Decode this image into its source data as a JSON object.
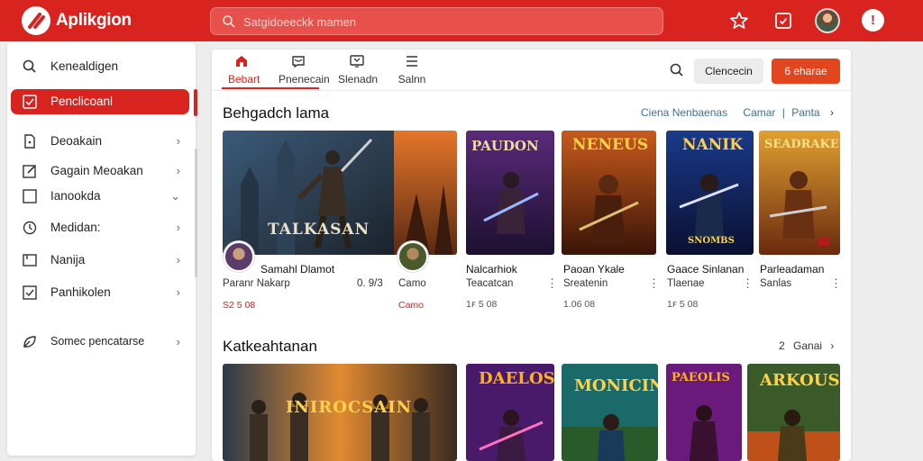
{
  "app": {
    "title": "Aplikgion"
  },
  "search": {
    "placeholder": "Satgidoeeckk mamen"
  },
  "sidebar": {
    "items": [
      {
        "label": "Kenealdigen",
        "icon": "search-icon"
      },
      {
        "label": "Penclicoanl",
        "icon": "checkbox-icon",
        "active": true
      },
      {
        "label": "Deoakain",
        "icon": "document-icon",
        "chevron": "›"
      },
      {
        "label": "Gagain Meoakan",
        "icon": "edit-icon",
        "chevron": "›"
      },
      {
        "label": "Ianookda",
        "icon": "square-icon",
        "chevron": "⌄"
      },
      {
        "label": "Medidan:",
        "icon": "clock-icon",
        "chevron": "›"
      },
      {
        "label": "Nanija",
        "icon": "box-icon",
        "chevron": "›"
      },
      {
        "label": "Panhikolen",
        "icon": "check-square-icon",
        "chevron": "›"
      },
      {
        "label": "Somec pencatarse",
        "icon": "leaf-icon",
        "chevron": "›"
      }
    ]
  },
  "tabs": [
    {
      "label": "Bebart",
      "icon": "home-icon",
      "active": true
    },
    {
      "label": "Pnenecain",
      "icon": "message-icon"
    },
    {
      "label": "Slenadn",
      "icon": "tv-icon"
    },
    {
      "label": "Salnn",
      "icon": "menu-icon"
    }
  ],
  "header_buttons": {
    "secondary": "Clencecin",
    "primary": "6 eharae"
  },
  "section1": {
    "title": "Behgadch lama",
    "link_a": "Ciena Nenbaenas",
    "link_b": "Camar",
    "link_c": "Panta",
    "link_chevron": "›",
    "cards": [
      {
        "title": "Samahl Dlamot",
        "sub": "Paranr Nakarp",
        "meta": "S2 5 08",
        "extra": "0. 9/3",
        "cover_text": "TALKASAN",
        "red_meta": true
      },
      {
        "title": "",
        "sub": "Camo",
        "meta": "",
        "red_sub": true
      },
      {
        "title": "Nalcarhiok",
        "sub": "Teacatcan",
        "meta": "1ꜰ 5 08",
        "cover_text": "PAUDON"
      },
      {
        "title": "Paoan Ykale",
        "sub": "Sreatenin",
        "meta": "1.06 08",
        "cover_text": "NENEUS"
      },
      {
        "title": "Gaace Sinlanan",
        "sub": "Tlaenae",
        "meta": "1ꜰ 5 08",
        "cover_text": "NANIK",
        "cover_sub": "SNOMBS"
      },
      {
        "title": "Parleadaman",
        "sub": "Sanlas",
        "meta": "",
        "cover_text": "SEADRAKE"
      }
    ]
  },
  "section2": {
    "title": "Katkeahtanan",
    "see_all": "Ganai",
    "see_all_num": "2",
    "cards": [
      {
        "cover_text": "INIROCSAIN"
      },
      {
        "cover_text": "DAELOS"
      },
      {
        "cover_text": "MONICIN"
      },
      {
        "cover_text": "PAEOLIS"
      },
      {
        "cover_text": "ARKOUS"
      }
    ]
  },
  "colors": {
    "brand": "#d8231f",
    "accent": "#e2461e",
    "link": "#3c6fa3"
  }
}
